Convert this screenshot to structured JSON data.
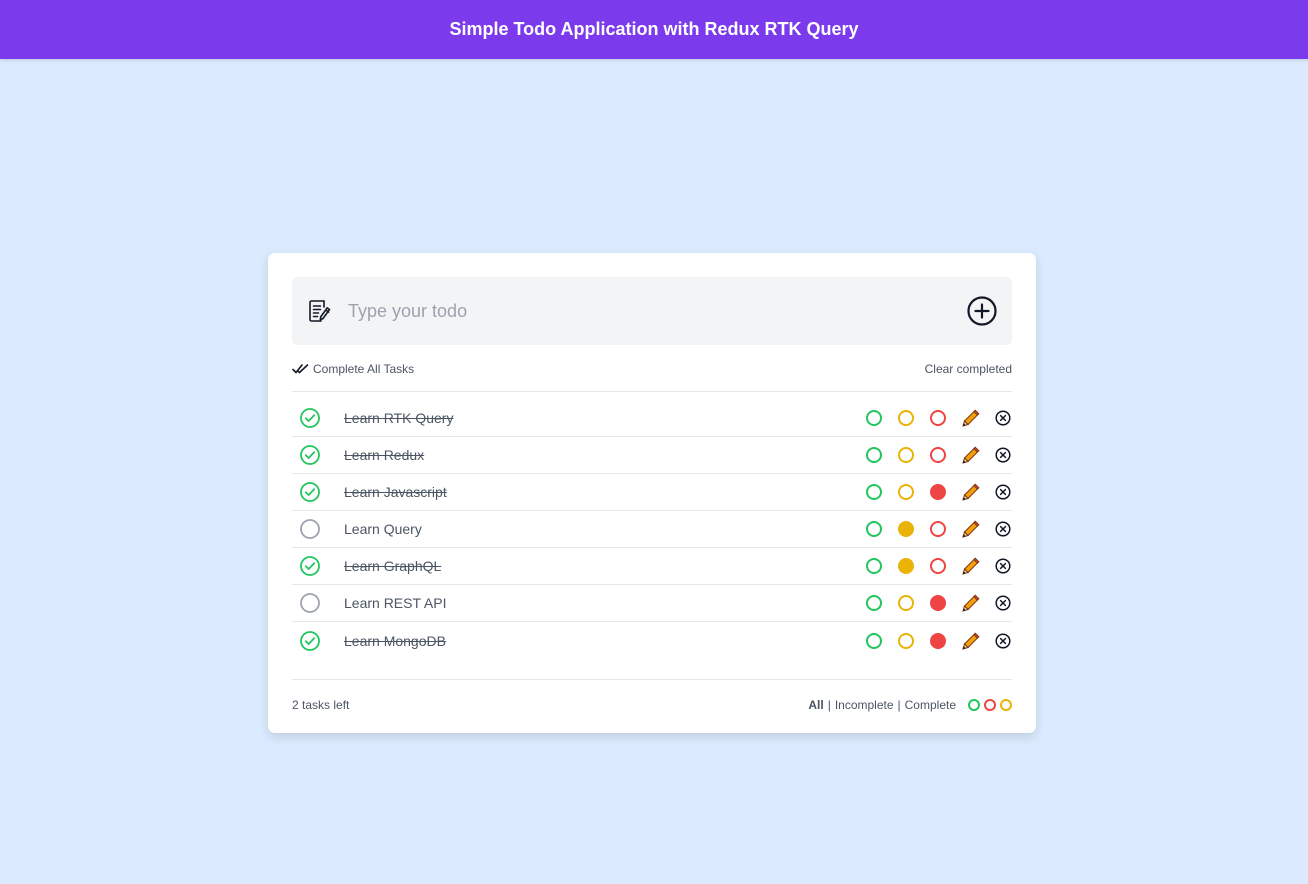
{
  "header": {
    "title": "Simple Todo Application with Redux RTK Query"
  },
  "input": {
    "placeholder": "Type your todo",
    "value": ""
  },
  "actions": {
    "complete_all_label": "Complete All Tasks",
    "clear_completed_label": "Clear completed"
  },
  "colors": {
    "green": "#22c55e",
    "yellow": "#eab308",
    "red": "#ef4444",
    "purple": "#7c3aed",
    "background": "#dbeafe"
  },
  "todos": [
    {
      "text": "Learn RTK Query",
      "completed": true,
      "color": "none"
    },
    {
      "text": "Learn Redux",
      "completed": true,
      "color": "none"
    },
    {
      "text": "Learn Javascript",
      "completed": true,
      "color": "red"
    },
    {
      "text": "Learn Query",
      "completed": false,
      "color": "yellow"
    },
    {
      "text": "Learn GraphQL",
      "completed": true,
      "color": "yellow"
    },
    {
      "text": "Learn REST API",
      "completed": false,
      "color": "red"
    },
    {
      "text": "Learn MongoDB",
      "completed": true,
      "color": "red"
    }
  ],
  "footer": {
    "tasks_left": "2 tasks left",
    "filters": [
      {
        "label": "All",
        "active": true
      },
      {
        "label": "Incomplete",
        "active": false
      },
      {
        "label": "Complete",
        "active": false
      }
    ],
    "color_filters": [
      "green",
      "red",
      "yellow"
    ]
  }
}
